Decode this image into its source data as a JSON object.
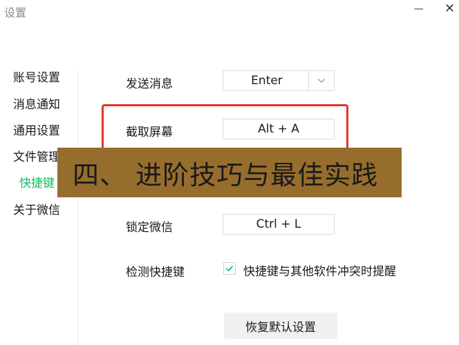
{
  "window": {
    "title": "设置",
    "minimize_glyph": "—",
    "close_glyph": "✕"
  },
  "sidebar": {
    "items": [
      {
        "label": "账号设置",
        "active": false
      },
      {
        "label": "消息通知",
        "active": false
      },
      {
        "label": "通用设置",
        "active": false
      },
      {
        "label": "文件管理",
        "active": false
      },
      {
        "label": "快捷键",
        "active": true
      },
      {
        "label": "关于微信",
        "active": false
      }
    ]
  },
  "shortcuts": {
    "send": {
      "label": "发送消息",
      "key": "Enter"
    },
    "screenshot": {
      "label": "截取屏幕",
      "key": "Alt + A"
    },
    "lock": {
      "label": "锁定微信",
      "key": "Ctrl + L"
    }
  },
  "detect": {
    "label": "检测快捷键",
    "checkbox_label": "快捷键与其他软件冲突时提醒",
    "checked": true
  },
  "restore_button": "恢复默认设置",
  "banner": {
    "text": "四、 进阶技巧与最佳实践"
  },
  "colors": {
    "accent": "#07c160",
    "highlight": "#e8312e",
    "banner_bg": "#976d2d"
  },
  "icons": {
    "dropdown": "chevron-down-icon",
    "check": "check-icon",
    "close": "close-icon",
    "minimize": "minimize-icon"
  }
}
